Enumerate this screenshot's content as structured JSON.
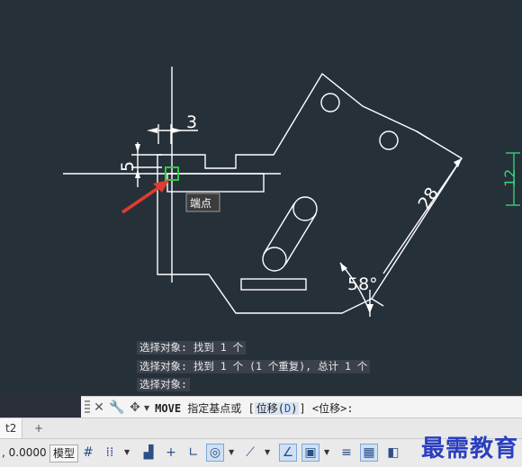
{
  "drawing": {
    "dim_top": "3",
    "dim_left": "5",
    "dim_right": "28",
    "dim_green": "12",
    "angle": "58°",
    "tooltip": "端点"
  },
  "command_history": [
    "选择对象: 找到 1 个",
    "选择对象: 找到 1 个 (1 个重复), 总计 1 个",
    "选择对象:"
  ],
  "command_line": {
    "cmd": "MOVE",
    "prompt": " 指定基点或 [",
    "option": "位移(",
    "option_key": "D",
    "option_close": ")",
    "tail": "] <位移>:"
  },
  "layout_tab": "t2",
  "status": {
    "coord": ", 0.0000",
    "model": "模型"
  },
  "watermark": "最需教育",
  "colors": {
    "background": "#263039",
    "geometry": "#ffffff",
    "snap_marker": "#2ecc40",
    "arrow": "#e03c31",
    "dimension_green": "#33d17a"
  }
}
